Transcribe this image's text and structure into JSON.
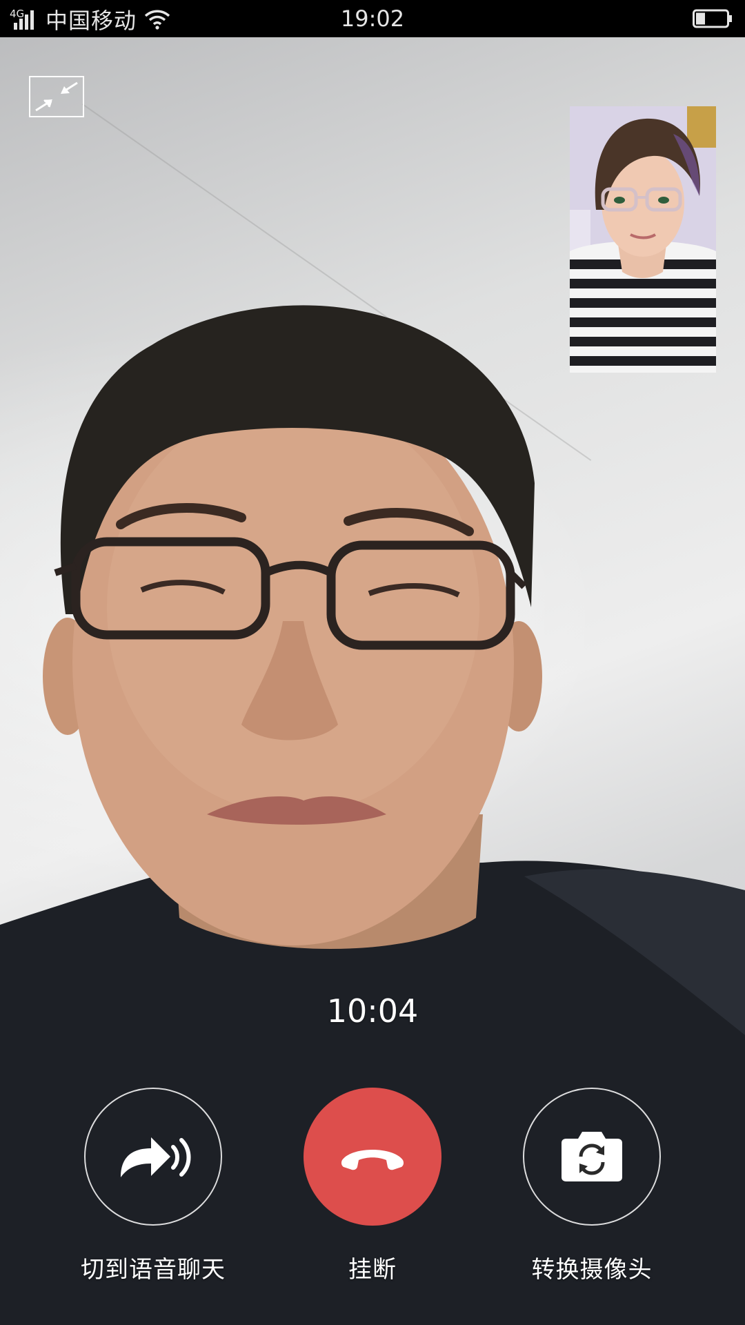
{
  "status_bar": {
    "network_type": "4G",
    "carrier": "中国移动",
    "time": "19:02",
    "icons": [
      "signal-icon",
      "wifi-icon",
      "battery-icon"
    ]
  },
  "video_call": {
    "minimize_icon": "minimize-arrows-icon",
    "call_duration": "10:04",
    "controls": [
      {
        "name": "switch-to-voice",
        "icon": "voice-forward-icon",
        "label": "切到语音聊天"
      },
      {
        "name": "hang-up",
        "icon": "phone-hangup-icon",
        "label": "挂断"
      },
      {
        "name": "switch-camera",
        "icon": "camera-switch-icon",
        "label": "转换摄像头"
      }
    ]
  },
  "colors": {
    "hangup_red": "#dd4e4c",
    "status_bar_bg": "#000000",
    "text": "#ffffff"
  }
}
